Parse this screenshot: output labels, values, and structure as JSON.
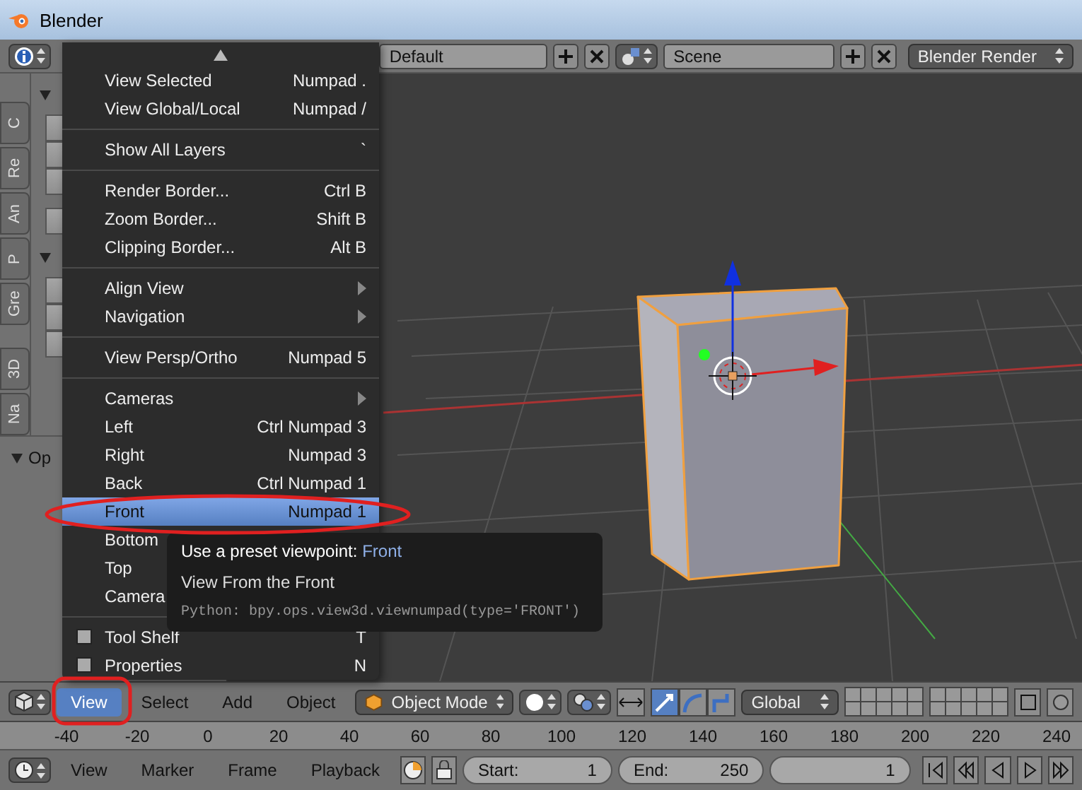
{
  "window": {
    "title": "Blender"
  },
  "info_header": {
    "screen_layout": "Default",
    "scene": "Scene",
    "render_engine": "Blender Render"
  },
  "tool_shelf": {
    "tabs": [
      {
        "label": "C",
        "selected": false
      },
      {
        "label": "Re",
        "selected": false
      },
      {
        "label": "An",
        "selected": false
      },
      {
        "label": "P",
        "selected": false
      },
      {
        "label": "Gre",
        "selected": false
      },
      {
        "label": "3D",
        "selected": false
      },
      {
        "label": "Na",
        "selected": false
      }
    ],
    "panels": [
      {
        "expanded": true
      },
      {
        "expanded": true
      }
    ],
    "operator_panel": {
      "title": "Op",
      "expanded": true
    }
  },
  "view_menu": {
    "items": [
      {
        "kind": "item",
        "label": "View Selected",
        "shortcut": "Numpad .",
        "selected": false
      },
      {
        "kind": "item",
        "label": "View Global/Local",
        "shortcut": "Numpad /",
        "selected": false
      },
      {
        "kind": "separator"
      },
      {
        "kind": "item",
        "label": "Show All Layers",
        "shortcut": "`",
        "selected": false
      },
      {
        "kind": "separator"
      },
      {
        "kind": "item",
        "label": "Render Border...",
        "shortcut": "Ctrl B",
        "selected": false
      },
      {
        "kind": "item",
        "label": "Zoom Border...",
        "shortcut": "Shift B",
        "selected": false
      },
      {
        "kind": "item",
        "label": "Clipping Border...",
        "shortcut": "Alt B",
        "selected": false
      },
      {
        "kind": "separator"
      },
      {
        "kind": "submenu",
        "label": "Align View",
        "selected": false
      },
      {
        "kind": "submenu",
        "label": "Navigation",
        "selected": false
      },
      {
        "kind": "separator"
      },
      {
        "kind": "item",
        "label": "View Persp/Ortho",
        "shortcut": "Numpad 5",
        "selected": false
      },
      {
        "kind": "separator"
      },
      {
        "kind": "submenu",
        "label": "Cameras",
        "selected": false
      },
      {
        "kind": "item",
        "label": "Left",
        "shortcut": "Ctrl Numpad 3",
        "selected": false
      },
      {
        "kind": "item",
        "label": "Right",
        "shortcut": "Numpad 3",
        "selected": false
      },
      {
        "kind": "item",
        "label": "Back",
        "shortcut": "Ctrl Numpad 1",
        "selected": false
      },
      {
        "kind": "item",
        "label": "Front",
        "shortcut": "Numpad 1",
        "selected": true
      },
      {
        "kind": "item",
        "label": "Bottom",
        "selected": false
      },
      {
        "kind": "item",
        "label": "Top",
        "selected": false
      },
      {
        "kind": "item",
        "label": "Camera",
        "selected": false
      },
      {
        "kind": "separator"
      },
      {
        "kind": "checkbox",
        "label": "Tool Shelf",
        "shortcut": "T",
        "checked": false,
        "selected": false
      },
      {
        "kind": "checkbox",
        "label": "Properties",
        "shortcut": "N",
        "checked": false,
        "selected": false
      }
    ]
  },
  "tooltip": {
    "title": "Use a preset viewpoint:",
    "value": "Front",
    "description": "View From the Front",
    "python": "Python: bpy.ops.view3d.viewnumpad(type='FRONT')"
  },
  "view3d_header": {
    "menus": [
      {
        "label": "View",
        "selected": true
      },
      {
        "label": "Select",
        "selected": false
      },
      {
        "label": "Add",
        "selected": false
      },
      {
        "label": "Object",
        "selected": false
      }
    ],
    "mode": "Object Mode",
    "transform_orientation": "Global",
    "manipulators": [
      {
        "kind": "translate",
        "on": true
      },
      {
        "kind": "rotate",
        "on": false
      },
      {
        "kind": "scale",
        "on": false
      }
    ]
  },
  "timeline": {
    "ruler": [
      "-40",
      "-20",
      "0",
      "20",
      "40",
      "60",
      "80",
      "100",
      "120",
      "140",
      "160",
      "180",
      "200",
      "220",
      "240"
    ],
    "menus": [
      "View",
      "Marker",
      "Frame",
      "Playback"
    ],
    "start_label": "Start:",
    "start": "1",
    "end_label": "End:",
    "end": "250",
    "current_frame": "1"
  }
}
